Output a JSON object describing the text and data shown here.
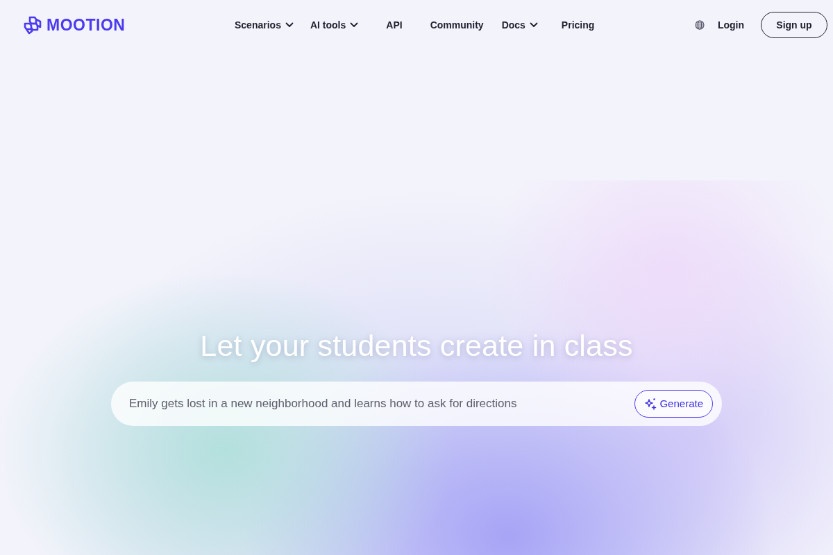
{
  "header": {
    "logo": {
      "text": "MOOTION"
    },
    "nav": [
      {
        "label": "Scenarios",
        "kind": "dropdown"
      },
      {
        "label": "AI tools",
        "kind": "dropdown"
      },
      {
        "label": "API",
        "kind": "link"
      },
      {
        "label": "Community",
        "kind": "link"
      },
      {
        "label": "Docs",
        "kind": "dropdown"
      },
      {
        "label": "Pricing",
        "kind": "link"
      }
    ],
    "login": "Login",
    "signup": "Sign up"
  },
  "hero": {
    "headline": "Let your students create in class",
    "prompt": {
      "placeholder": "Emily gets lost in a new neighborhood and learns how to ask for directions"
    },
    "generate_button": "Generate"
  }
}
